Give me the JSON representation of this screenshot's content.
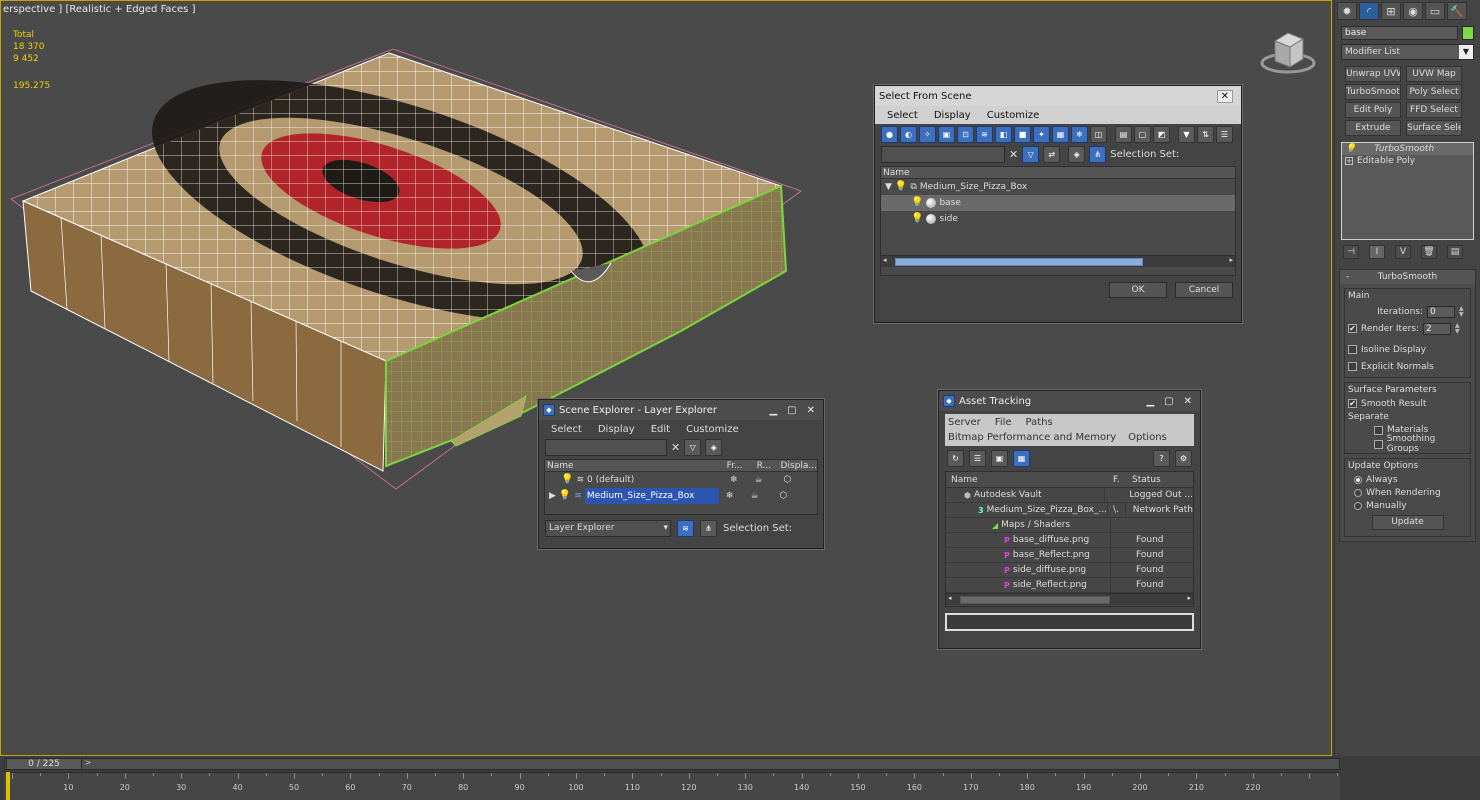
{
  "viewport": {
    "label": "erspective ] [Realistic + Edged Faces ]",
    "stats": {
      "total_label": "Total",
      "polys": "18 370",
      "verts": "9 452",
      "fps": "195.275"
    }
  },
  "command_panel": {
    "tabs": [
      "create-icon",
      "modify-icon",
      "hierarchy-icon",
      "motion-icon",
      "display-icon",
      "utilities-icon"
    ],
    "object_name": "base",
    "object_color": "#7fd84a",
    "modifier_list": "Modifier List",
    "modifier_buttons": [
      "Unwrap UVW",
      "UVW Map",
      "TurboSmooth",
      "Poly Select",
      "Edit Poly",
      "FFD Select",
      "Extrude",
      "Surface Select"
    ],
    "stack": [
      "TurboSmooth",
      "Editable Poly"
    ],
    "turbosmooth": {
      "title": "TurboSmooth",
      "main_label": "Main",
      "iterations_label": "Iterations:",
      "iterations": "0",
      "render_iters_label": "Render Iters:",
      "render_iters": "2",
      "render_iters_checked": true,
      "isoline_label": "Isoline Display",
      "explicit_label": "Explicit Normals",
      "surface_label": "Surface Parameters",
      "smooth_result_label": "Smooth Result",
      "separate_label": "Separate",
      "materials_label": "Materials",
      "smoothing_groups_label": "Smoothing Groups",
      "update_options_label": "Update Options",
      "always_label": "Always",
      "when_rendering_label": "When Rendering",
      "manually_label": "Manually",
      "update_label": "Update"
    }
  },
  "select_from_scene": {
    "title": "Select From Scene",
    "menus": [
      "Select",
      "Display",
      "Customize"
    ],
    "selection_set_label": "Selection Set:",
    "column_name": "Name",
    "root": "Medium_Size_Pizza_Box",
    "children": [
      "base",
      "side"
    ],
    "ok_label": "OK",
    "cancel_label": "Cancel"
  },
  "scene_explorer": {
    "title": "Scene Explorer - Layer Explorer",
    "menus": [
      "Select",
      "Display",
      "Edit",
      "Customize"
    ],
    "columns": [
      "Name",
      "Fr...",
      "R...",
      "Displa..."
    ],
    "rows": [
      "0 (default)",
      "Medium_Size_Pizza_Box"
    ],
    "explorer_dropdown": "Layer Explorer",
    "selection_set_label": "Selection Set:"
  },
  "asset_tracking": {
    "title": "Asset Tracking",
    "menus_row1": [
      "Server",
      "File",
      "Paths"
    ],
    "menus_row2": [
      "Bitmap Performance and Memory",
      "Options"
    ],
    "columns": [
      "Name",
      "F.",
      "Status"
    ],
    "rows": [
      {
        "name": "Autodesk Vault",
        "f": "",
        "status": "Logged Out ..."
      },
      {
        "name": "Medium_Size_Pizza_Box_...",
        "f": "\\.",
        "status": "Network Path"
      },
      {
        "name": "Maps / Shaders",
        "f": "",
        "status": ""
      },
      {
        "name": "base_diffuse.png",
        "f": "",
        "status": "Found"
      },
      {
        "name": "base_Reflect.png",
        "f": "",
        "status": "Found"
      },
      {
        "name": "side_diffuse.png",
        "f": "",
        "status": "Found"
      },
      {
        "name": "side_Reflect.png",
        "f": "",
        "status": "Found"
      }
    ]
  },
  "timeline": {
    "frame_display": "0 / 225",
    "next_label": ">",
    "ticks": [
      "10",
      "20",
      "30",
      "40",
      "50",
      "60",
      "70",
      "80",
      "90",
      "100",
      "110",
      "120",
      "130",
      "140",
      "150",
      "160",
      "170",
      "180",
      "190",
      "200",
      "210",
      "220"
    ]
  }
}
